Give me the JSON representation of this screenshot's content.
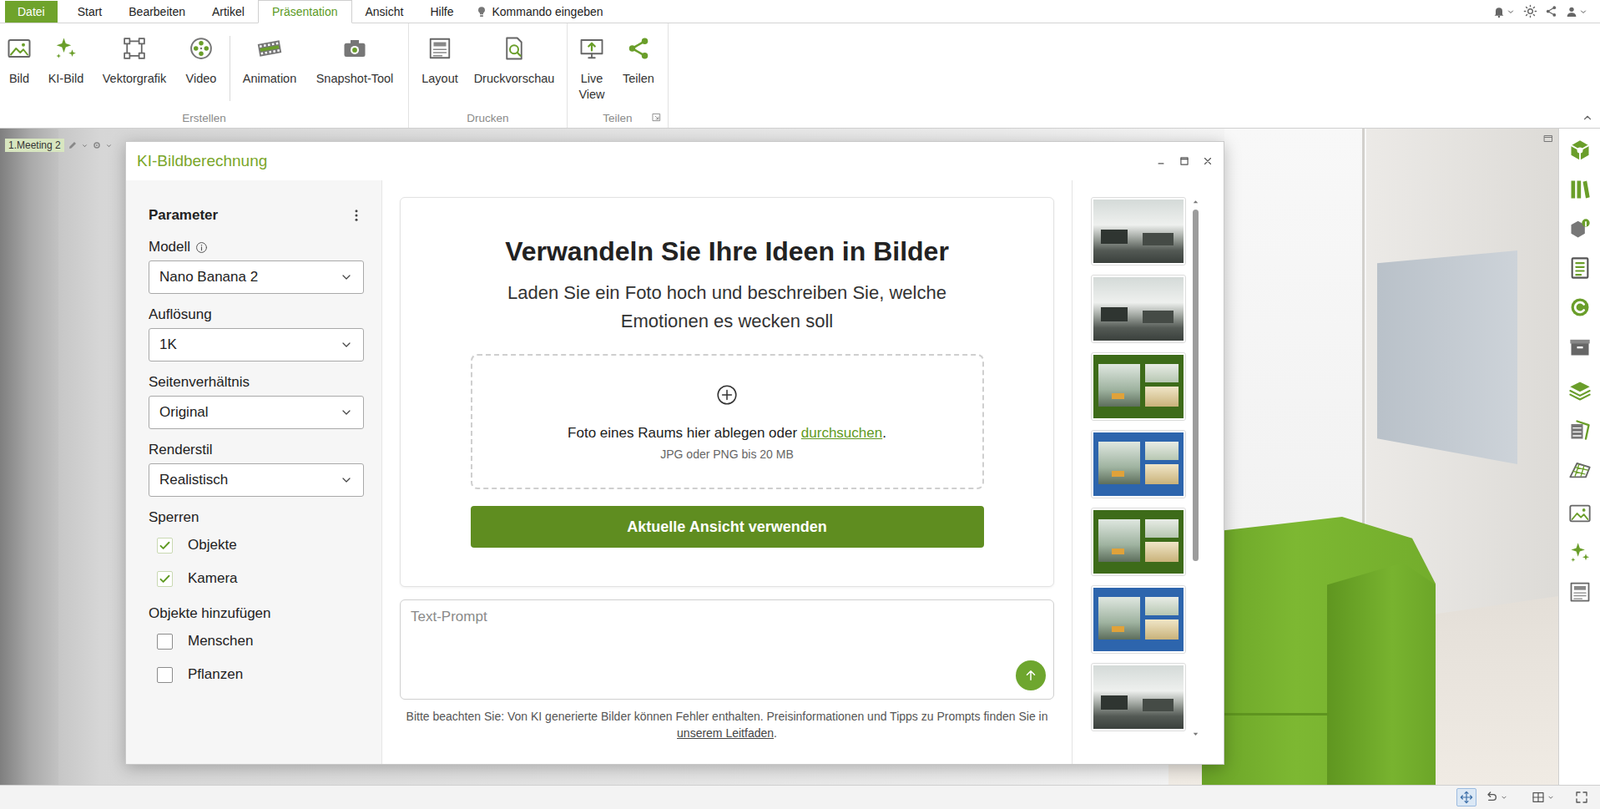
{
  "menu": {
    "tabs": [
      {
        "label": "Datei",
        "kind": "file",
        "selected": false
      },
      {
        "label": "Start",
        "kind": "tab",
        "selected": false
      },
      {
        "label": "Bearbeiten",
        "kind": "tab",
        "selected": false
      },
      {
        "label": "Artikel",
        "kind": "tab",
        "selected": false
      },
      {
        "label": "Präsentation",
        "kind": "tab",
        "selected": true
      },
      {
        "label": "Ansicht",
        "kind": "tab",
        "selected": false
      },
      {
        "label": "Hilfe",
        "kind": "tab",
        "selected": false
      }
    ],
    "command": "Kommando eingeben"
  },
  "ribbon": {
    "groups": [
      {
        "label": "Erstellen",
        "buttons": [
          {
            "label": "Bild"
          },
          {
            "label": "KI-Bild"
          },
          {
            "label": "Vektorgrafik"
          },
          {
            "label": "Video"
          },
          {
            "label": "Animation"
          },
          {
            "label": "Snapshot-Tool"
          }
        ]
      },
      {
        "label": "Drucken",
        "buttons": [
          {
            "label": "Layout"
          },
          {
            "label": "Druckvorschau"
          }
        ]
      },
      {
        "label": "Teilen",
        "buttons": [
          {
            "label": "Live View"
          },
          {
            "label": "Teilen"
          }
        ]
      }
    ]
  },
  "view": {
    "tab": "1.Meeting 2"
  },
  "dialog": {
    "title": "KI-Bildberechnung",
    "parameters": {
      "title": "Parameter",
      "fields": [
        {
          "label": "Modell",
          "value": "Nano Banana 2"
        },
        {
          "label": "Auflösung",
          "value": "1K"
        },
        {
          "label": "Seitenverhältnis",
          "value": "Original"
        },
        {
          "label": "Renderstil",
          "value": "Realistisch"
        }
      ],
      "lock": {
        "title": "Sperren",
        "options": [
          {
            "label": "Objekte",
            "checked": true
          },
          {
            "label": "Kamera",
            "checked": true
          }
        ]
      },
      "add": {
        "title": "Objekte hinzufügen",
        "options": [
          {
            "label": "Menschen",
            "checked": false
          },
          {
            "label": "Pflanzen",
            "checked": false
          }
        ]
      }
    },
    "hero": {
      "title": "Verwandeln Sie Ihre Ideen in Bilder",
      "subtitle": "Laden Sie ein Foto hoch und beschreiben Sie, welche Emotionen es wecken soll"
    },
    "dropzone": {
      "text": "Foto eines Raums hier ablegen oder ",
      "link": "durchsuchen",
      "after": ".",
      "hint": "JPG oder PNG bis 20 MB"
    },
    "action": "Aktuelle Ansicht verwenden",
    "prompt": {
      "placeholder": "Text-Prompt"
    },
    "note": {
      "text": "Bitte beachten Sie: Von KI generierte Bilder können Fehler enthalten. Preisinformationen und Tipps zu Prompts finden Sie in ",
      "link": "unserem Leitfaden",
      "after": "."
    },
    "history": {
      "items": [
        {
          "kind": "photo"
        },
        {
          "kind": "photo"
        },
        {
          "kind": "green"
        },
        {
          "kind": "blue"
        },
        {
          "kind": "green"
        },
        {
          "kind": "blue"
        },
        {
          "kind": "photo"
        },
        {
          "kind": "photo"
        }
      ],
      "scrollbar": {
        "level": 0.68
      }
    }
  }
}
